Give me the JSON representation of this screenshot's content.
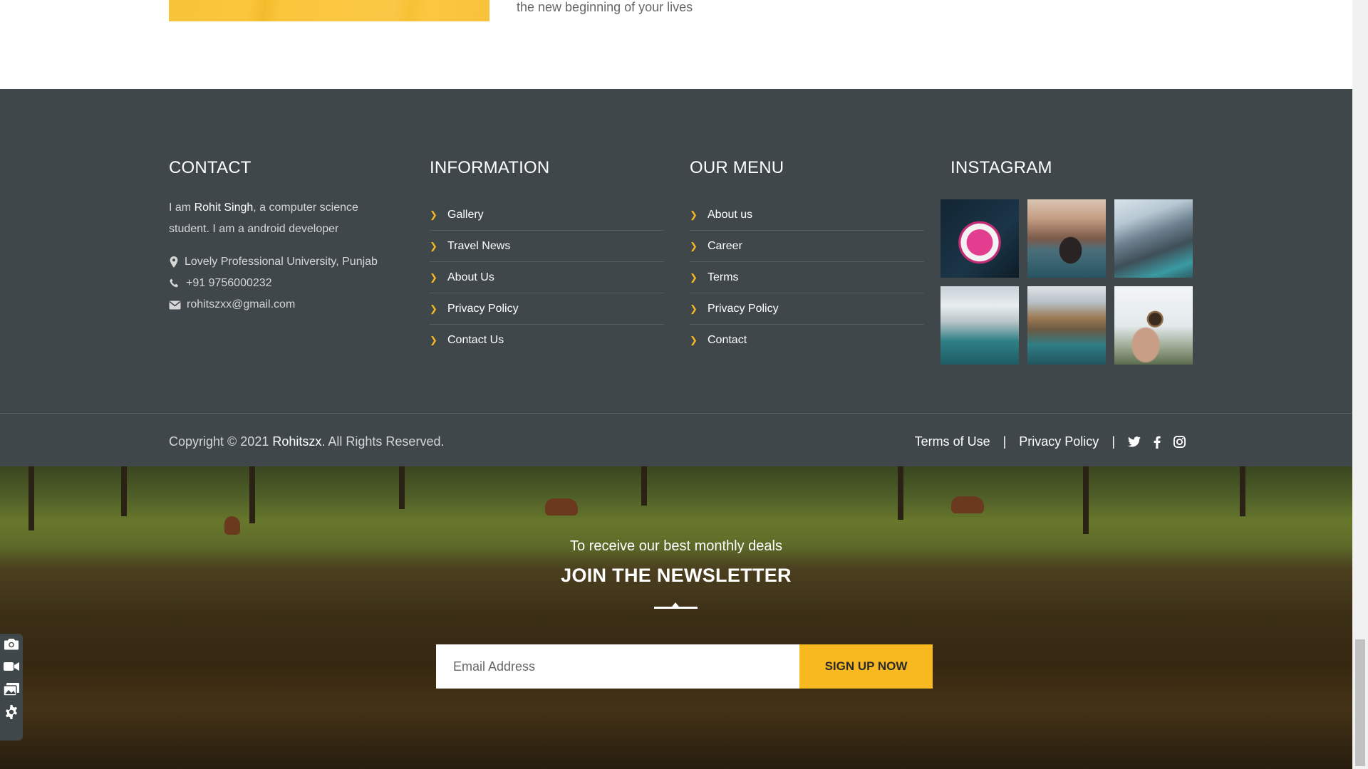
{
  "top": {
    "text": "the new beginning of your lives"
  },
  "footer": {
    "contact": {
      "heading": "CONTACT",
      "intro_before": "I am ",
      "intro_name": "Rohit Singh",
      "intro_after": ", a computer science student. I am a android developer",
      "address": "Lovely Professional University, Punjab",
      "phone": "+91 9756000232",
      "email": "rohitszxx@gmail.com"
    },
    "information": {
      "heading": "INFORMATION",
      "items": [
        "Gallery",
        "Travel News",
        "About Us",
        "Privacy Policy",
        "Contact Us"
      ]
    },
    "our_menu": {
      "heading": "OUR MENU",
      "items": [
        "About us",
        "Career",
        "Terms",
        "Privacy Policy",
        "Contact"
      ]
    },
    "instagram": {
      "heading": "INSTAGRAM"
    },
    "copyright_before": "Copyright © 2021 ",
    "copyright_brand": "Rohitszx",
    "copyright_after": ". All Rights Reserved.",
    "legal": {
      "terms": "Terms of Use",
      "privacy": "Privacy Policy",
      "pipe": "|"
    }
  },
  "newsletter": {
    "subtitle": "To receive our best monthly deals",
    "title": "JOIN THE NEWSLETTER",
    "placeholder": "Email Address",
    "button": "SIGN UP NOW"
  },
  "colors": {
    "accent": "#f8b820",
    "footer_bg": "#3f474b"
  }
}
